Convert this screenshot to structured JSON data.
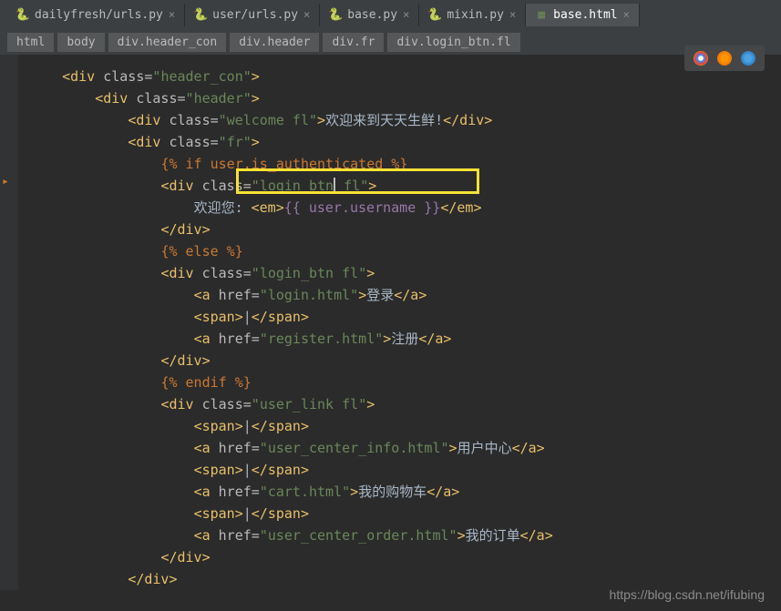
{
  "tabs": [
    {
      "label": "dailyfresh/urls.py",
      "type": "py"
    },
    {
      "label": "user/urls.py",
      "type": "py"
    },
    {
      "label": "base.py",
      "type": "py"
    },
    {
      "label": "mixin.py",
      "type": "py"
    },
    {
      "label": "base.html",
      "type": "html",
      "active": true
    }
  ],
  "breadcrumb": [
    "html",
    "body",
    "div.header_con",
    "div.header",
    "div.fr",
    "div.login_btn.fl"
  ],
  "code": {
    "l1": {
      "indent": "  ",
      "tag": "div",
      "attr": "class",
      "val": "header_con"
    },
    "l2": {
      "indent": "      ",
      "tag": "div",
      "attr": "class",
      "val": "header"
    },
    "l3": {
      "indent": "          ",
      "tag": "div",
      "attr": "class",
      "val": "welcome fl",
      "text": "欢迎来到天天生鲜!",
      "close": "div"
    },
    "l4": {
      "indent": "          ",
      "tag": "div",
      "attr": "class",
      "val": "fr"
    },
    "l5": {
      "indent": "              ",
      "tmpl": "{% if user.is_authenticated %}"
    },
    "l6": {
      "indent": "              ",
      "tag": "div",
      "attr": "class",
      "val": "login_btn fl"
    },
    "l7": {
      "indent": "                  ",
      "text1": "欢迎您:",
      "etag": "em",
      "var": "{{ user.username }}"
    },
    "l8": {
      "indent": "              ",
      "close": "div"
    },
    "l9": {
      "indent": "              ",
      "tmpl": "{% else %}"
    },
    "l10": {
      "indent": "              ",
      "tag": "div",
      "attr": "class",
      "val": "login_btn fl"
    },
    "l11": {
      "indent": "                  ",
      "tag": "a",
      "attr": "href",
      "val": "login.html",
      "text": "登录",
      "close": "a"
    },
    "l12": {
      "indent": "                  ",
      "tag": "span",
      "text": "|",
      "close": "span"
    },
    "l13": {
      "indent": "                  ",
      "tag": "a",
      "attr": "href",
      "val": "register.html",
      "text": "注册",
      "close": "a"
    },
    "l14": {
      "indent": "              ",
      "close": "div"
    },
    "l15": {
      "indent": "              ",
      "tmpl": "{% endif %}"
    },
    "l16": {
      "indent": "              ",
      "tag": "div",
      "attr": "class",
      "val": "user_link fl"
    },
    "l17": {
      "indent": "                  ",
      "tag": "span",
      "text": "|",
      "close": "span"
    },
    "l18": {
      "indent": "                  ",
      "tag": "a",
      "attr": "href",
      "val": "user_center_info.html",
      "text": "用户中心",
      "close": "a"
    },
    "l19": {
      "indent": "                  ",
      "tag": "span",
      "text": "|",
      "close": "span"
    },
    "l20": {
      "indent": "                  ",
      "tag": "a",
      "attr": "href",
      "val": "cart.html",
      "text": "我的购物车",
      "close": "a"
    },
    "l21": {
      "indent": "                  ",
      "tag": "span",
      "text": "|",
      "close": "span"
    },
    "l22": {
      "indent": "                  ",
      "tag": "a",
      "attr": "href",
      "val": "user_center_order.html",
      "text": "我的订单",
      "close": "a"
    },
    "l23": {
      "indent": "              ",
      "close": "div"
    },
    "l24": {
      "indent": "          ",
      "close": "div"
    }
  },
  "watermark": "https://blog.csdn.net/ifubing"
}
